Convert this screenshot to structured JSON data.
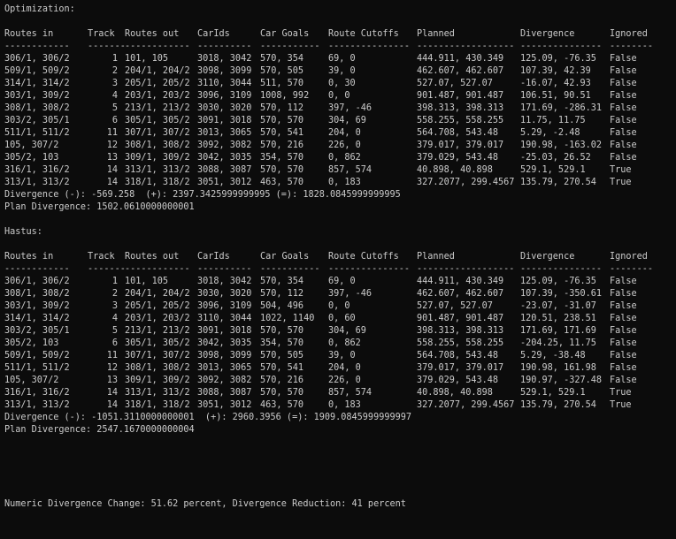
{
  "sections": [
    {
      "title": "Optimization:",
      "headers": [
        "Routes in",
        "Track",
        "Routes out",
        "CarIds",
        "Car Goals",
        "Route Cutoffs",
        "Planned",
        "Divergence",
        "Ignored"
      ],
      "separators": [
        "------------",
        "-------",
        "------------",
        "----------",
        "-----------",
        "---------------",
        "------------------",
        "---------------",
        "--------"
      ],
      "rows": [
        [
          "306/1, 306/2",
          "1",
          "101, 105",
          "3018, 3042",
          "570, 354",
          "69, 0",
          "444.911, 430.349",
          "125.09, -76.35",
          "False"
        ],
        [
          "509/1, 509/2",
          "2",
          "204/1, 204/2",
          "3098, 3099",
          "570, 505",
          "39, 0",
          "462.607, 462.607",
          "107.39, 42.39",
          "False"
        ],
        [
          "314/1, 314/2",
          "3",
          "205/1, 205/2",
          "3110, 3044",
          "511, 570",
          "0, 30",
          "527.07, 527.07",
          "-16.07, 42.93",
          "False"
        ],
        [
          "303/1, 309/2",
          "4",
          "203/1, 203/2",
          "3096, 3109",
          "1008, 992",
          "0, 0",
          "901.487, 901.487",
          "106.51, 90.51",
          "False"
        ],
        [
          "308/1, 308/2",
          "5",
          "213/1, 213/2",
          "3030, 3020",
          "570, 112",
          "397, -46",
          "398.313, 398.313",
          "171.69, -286.31",
          "False"
        ],
        [
          "303/2, 305/1",
          "6",
          "305/1, 305/2",
          "3091, 3018",
          "570, 570",
          "304, 69",
          "558.255, 558.255",
          "11.75, 11.75",
          "False"
        ],
        [
          "511/1, 511/2",
          "11",
          "307/1, 307/2",
          "3013, 3065",
          "570, 541",
          "204, 0",
          "564.708, 543.48",
          "5.29, -2.48",
          "False"
        ],
        [
          "105, 307/2",
          "12",
          "308/1, 308/2",
          "3092, 3082",
          "570, 216",
          "226, 0",
          "379.017, 379.017",
          "190.98, -163.02",
          "False"
        ],
        [
          "305/2, 103",
          "13",
          "309/1, 309/2",
          "3042, 3035",
          "354, 570",
          "0, 862",
          "379.029, 543.48",
          "-25.03, 26.52",
          "False"
        ],
        [
          "316/1, 316/2",
          "14",
          "313/1, 313/2",
          "3088, 3087",
          "570, 570",
          "857, 574",
          "40.898, 40.898",
          "529.1, 529.1",
          "True"
        ],
        [
          "313/1, 313/2",
          "14",
          "318/1, 318/2",
          "3051, 3012",
          "463, 570",
          "0, 183",
          "327.2077, 299.4567",
          "135.79, 270.54",
          "True"
        ]
      ],
      "divergence_line": "Divergence (-): -569.258  (+): 2397.3425999999995 (=): 1828.0845999999995",
      "plan_divergence_line": "Plan Divergence: 1502.0610000000001"
    },
    {
      "title": "Hastus:",
      "headers": [
        "Routes in",
        "Track",
        "Routes out",
        "CarIds",
        "Car Goals",
        "Route Cutoffs",
        "Planned",
        "Divergence",
        "Ignored"
      ],
      "separators": [
        "------------",
        "-------",
        "------------",
        "----------",
        "-----------",
        "---------------",
        "------------------",
        "---------------",
        "--------"
      ],
      "rows": [
        [
          "306/1, 306/2",
          "1",
          "101, 105",
          "3018, 3042",
          "570, 354",
          "69, 0",
          "444.911, 430.349",
          "125.09, -76.35",
          "False"
        ],
        [
          "308/1, 308/2",
          "2",
          "204/1, 204/2",
          "3030, 3020",
          "570, 112",
          "397, -46",
          "462.607, 462.607",
          "107.39, -350.61",
          "False"
        ],
        [
          "303/1, 309/2",
          "3",
          "205/1, 205/2",
          "3096, 3109",
          "504, 496",
          "0, 0",
          "527.07, 527.07",
          "-23.07, -31.07",
          "False"
        ],
        [
          "314/1, 314/2",
          "4",
          "203/1, 203/2",
          "3110, 3044",
          "1022, 1140",
          "0, 60",
          "901.487, 901.487",
          "120.51, 238.51",
          "False"
        ],
        [
          "303/2, 305/1",
          "5",
          "213/1, 213/2",
          "3091, 3018",
          "570, 570",
          "304, 69",
          "398.313, 398.313",
          "171.69, 171.69",
          "False"
        ],
        [
          "305/2, 103",
          "6",
          "305/1, 305/2",
          "3042, 3035",
          "354, 570",
          "0, 862",
          "558.255, 558.255",
          "-204.25, 11.75",
          "False"
        ],
        [
          "509/1, 509/2",
          "11",
          "307/1, 307/2",
          "3098, 3099",
          "570, 505",
          "39, 0",
          "564.708, 543.48",
          "5.29, -38.48",
          "False"
        ],
        [
          "511/1, 511/2",
          "12",
          "308/1, 308/2",
          "3013, 3065",
          "570, 541",
          "204, 0",
          "379.017, 379.017",
          "190.98, 161.98",
          "False"
        ],
        [
          "105, 307/2",
          "13",
          "309/1, 309/2",
          "3092, 3082",
          "570, 216",
          "226, 0",
          "379.029, 543.48",
          "190.97, -327.48",
          "False"
        ],
        [
          "316/1, 316/2",
          "14",
          "313/1, 313/2",
          "3088, 3087",
          "570, 570",
          "857, 574",
          "40.898, 40.898",
          "529.1, 529.1",
          "True"
        ],
        [
          "313/1, 313/2",
          "14",
          "318/1, 318/2",
          "3051, 3012",
          "463, 570",
          "0, 183",
          "327.2077, 299.4567",
          "135.79, 270.54",
          "True"
        ]
      ],
      "divergence_line": "Divergence (-): -1051.3110000000001  (+): 2960.3956 (=): 1909.0845999999997",
      "plan_divergence_line": "Plan Divergence: 2547.1670000000004"
    }
  ],
  "summary": "Numeric Divergence Change: 51.62 percent, Divergence Reduction: 41 percent",
  "colors": {
    "background": "#0c0c0c",
    "text": "#cccccc"
  }
}
